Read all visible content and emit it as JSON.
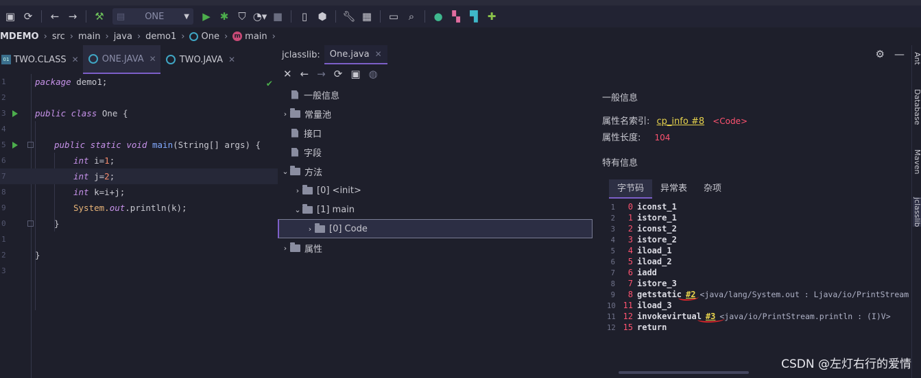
{
  "toolbar": {
    "run_config": "ONE",
    "icons": [
      "save-icon",
      "sync-icon",
      "back-icon",
      "forward-icon",
      "build-icon",
      "run-config-icon",
      "run-icon",
      "debug-icon",
      "coverage-icon",
      "profile-icon",
      "stop-icon",
      "device-icon",
      "sdk-icon",
      "wrench-icon",
      "structure-icon",
      "terminal-icon",
      "search-icon",
      "plugin-icon",
      "palette-icon",
      "tool-icon",
      "puzzle-icon"
    ]
  },
  "breadcrumb": {
    "project": "MDEMO",
    "items": [
      "src",
      "main",
      "java",
      "demo1",
      "One",
      "main"
    ]
  },
  "editor_tabs": [
    {
      "label": "TWO.CLASS",
      "active": false
    },
    {
      "label": "ONE.JAVA",
      "active": true
    },
    {
      "label": "TWO.JAVA",
      "active": false
    }
  ],
  "editor": {
    "line_numbers": [
      "1",
      "2",
      "3",
      "4",
      "5",
      "6",
      "7",
      "8",
      "9",
      "0",
      "1",
      "2",
      "3"
    ],
    "lines": {
      "l1_kw": "package",
      "l1_rest": " demo1;",
      "l3_kw": "public class",
      "l3_rest": " One {",
      "l5_kw": "public static void",
      "l5_fn": "main",
      "l5_rest": "(String[] args) {",
      "l6_kw": "int",
      "l6_rest": " i=",
      "l6_num": "1",
      "l6_end": ";",
      "l7_kw": "int",
      "l7_rest": " j=",
      "l7_num": "2",
      "l7_end": ";",
      "l8_kw": "int",
      "l8_rest": " k=i+j;",
      "l9_a": "System.",
      "l9_b": "out",
      "l9_c": ".println(k);",
      "l10": "}",
      "l12": "}"
    }
  },
  "jclasslib": {
    "label": "jclasslib:",
    "tab": "One.java",
    "tree": [
      {
        "label": "一般信息"
      },
      {
        "label": "常量池"
      },
      {
        "label": "接口"
      },
      {
        "label": "字段"
      },
      {
        "label": "方法"
      },
      {
        "label": "[0] <init>"
      },
      {
        "label": "[1] main"
      },
      {
        "label": "[0] Code"
      },
      {
        "label": "属性"
      }
    ],
    "info": {
      "heading": "一般信息",
      "attr_name_index_label": "属性名索引:",
      "attr_name_index_ref": "cp_info #8",
      "attr_name_index_val": "<Code>",
      "attr_length_label": "属性长度:",
      "attr_length_val": "104",
      "specific_heading": "特有信息",
      "tabs": [
        "字节码",
        "异常表",
        "杂项"
      ]
    },
    "bytecode": [
      {
        "ln": "1",
        "off": "0",
        "op": "iconst_1"
      },
      {
        "ln": "2",
        "off": "1",
        "op": "istore_1"
      },
      {
        "ln": "3",
        "off": "2",
        "op": "iconst_2"
      },
      {
        "ln": "4",
        "off": "3",
        "op": "istore_2"
      },
      {
        "ln": "5",
        "off": "4",
        "op": "iload_1"
      },
      {
        "ln": "6",
        "off": "5",
        "op": "iload_2"
      },
      {
        "ln": "7",
        "off": "6",
        "op": "iadd"
      },
      {
        "ln": "8",
        "off": "7",
        "op": "istore_3"
      },
      {
        "ln": "9",
        "off": "8",
        "op": "getstatic",
        "ref": "#2",
        "cmt": "<java/lang/System.out : Ljava/io/PrintStream"
      },
      {
        "ln": "10",
        "off": "11",
        "op": "iload_3"
      },
      {
        "ln": "11",
        "off": "12",
        "op": "invokevirtual",
        "ref": "#3",
        "cmt": "<java/io/PrintStream.println : (I)V>"
      },
      {
        "ln": "12",
        "off": "15",
        "op": "return"
      }
    ]
  },
  "sidebar": [
    "Ant",
    "Database",
    "Maven",
    "jclasslib"
  ],
  "watermark": "CSDN @左灯右行的爱情"
}
